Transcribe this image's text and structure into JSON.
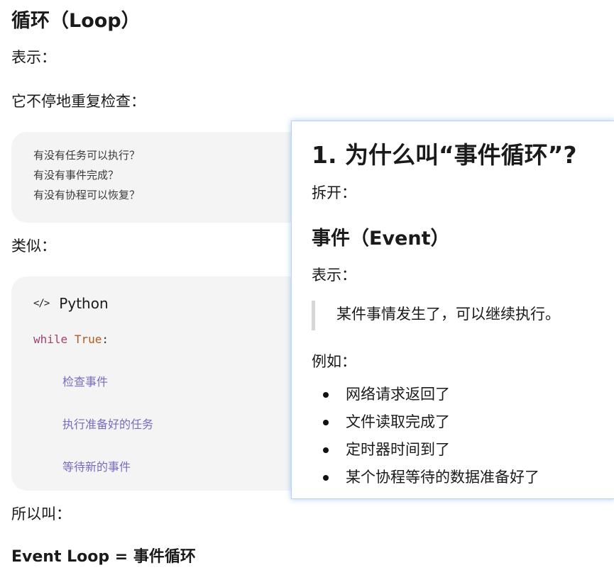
{
  "main": {
    "heading": "循环（Loop）",
    "repr_label": "表示：",
    "keeps_checking": "它不停地重复检查：",
    "check_lines": [
      "有没有任务可以执行？",
      "有没有事件完成？",
      "有没有协程可以恢复？"
    ],
    "similar_label": "类似：",
    "code_language": "Python",
    "code_keyword": "while",
    "code_builtin": "True",
    "code_colon": ":",
    "code_comments": [
      "检查事件",
      "执行准备好的任务",
      "等待新的事件"
    ],
    "so_called_label": "所以叫：",
    "conclusion": "Event Loop = 事件循环"
  },
  "overlay": {
    "title": "1. 为什么叫“事件循环”?",
    "split_label": "拆开：",
    "event_heading": "事件（Event）",
    "repr_label": "表示：",
    "quote": "某件事情发生了，可以继续执行。",
    "example_label": "例如：",
    "examples": [
      "网络请求返回了",
      "文件读取完成了",
      "定时器时间到了",
      "某个协程等待的数据准备好了"
    ]
  }
}
